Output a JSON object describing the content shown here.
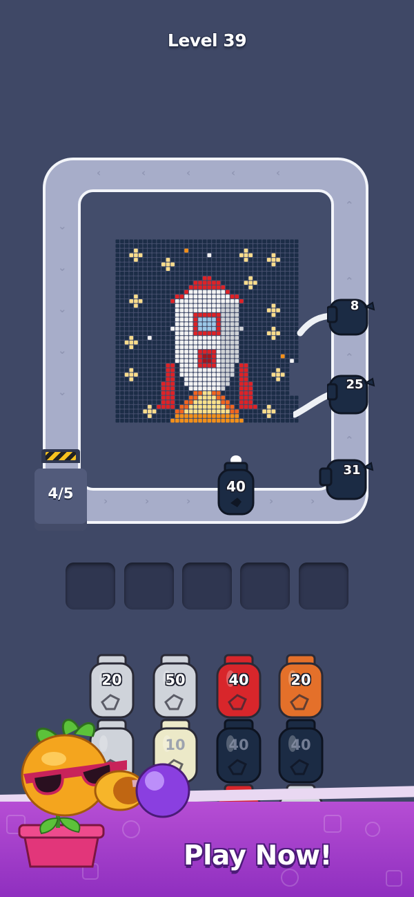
{
  "level_label": "Level 39",
  "machine": {
    "counter": "4/5"
  },
  "track_cans": [
    {
      "value": "8",
      "color": "#1b2b44"
    },
    {
      "value": "25",
      "color": "#1b2b44"
    },
    {
      "value": "31",
      "color": "#1b2b44"
    },
    {
      "value": "40",
      "color": "#1b2b44"
    }
  ],
  "empty_slots": 5,
  "shelf": {
    "row1": [
      {
        "value": "20",
        "color": "#cfd3da"
      },
      {
        "value": "50",
        "color": "#cfd3da"
      },
      {
        "value": "40",
        "color": "#d8262b"
      },
      {
        "value": "20",
        "color": "#e4702a"
      }
    ],
    "row2": [
      {
        "value": "",
        "color": "#cfd3da"
      },
      {
        "value": "10",
        "color": "#ece9c8"
      },
      {
        "value": "40",
        "color": "#1b2b44"
      },
      {
        "value": "40",
        "color": "#1b2b44"
      }
    ]
  },
  "cta": {
    "label": "Play Now!"
  },
  "colors": {
    "background": "#3f4866",
    "track": "#a7adc9",
    "banner": "#a63fcc"
  }
}
